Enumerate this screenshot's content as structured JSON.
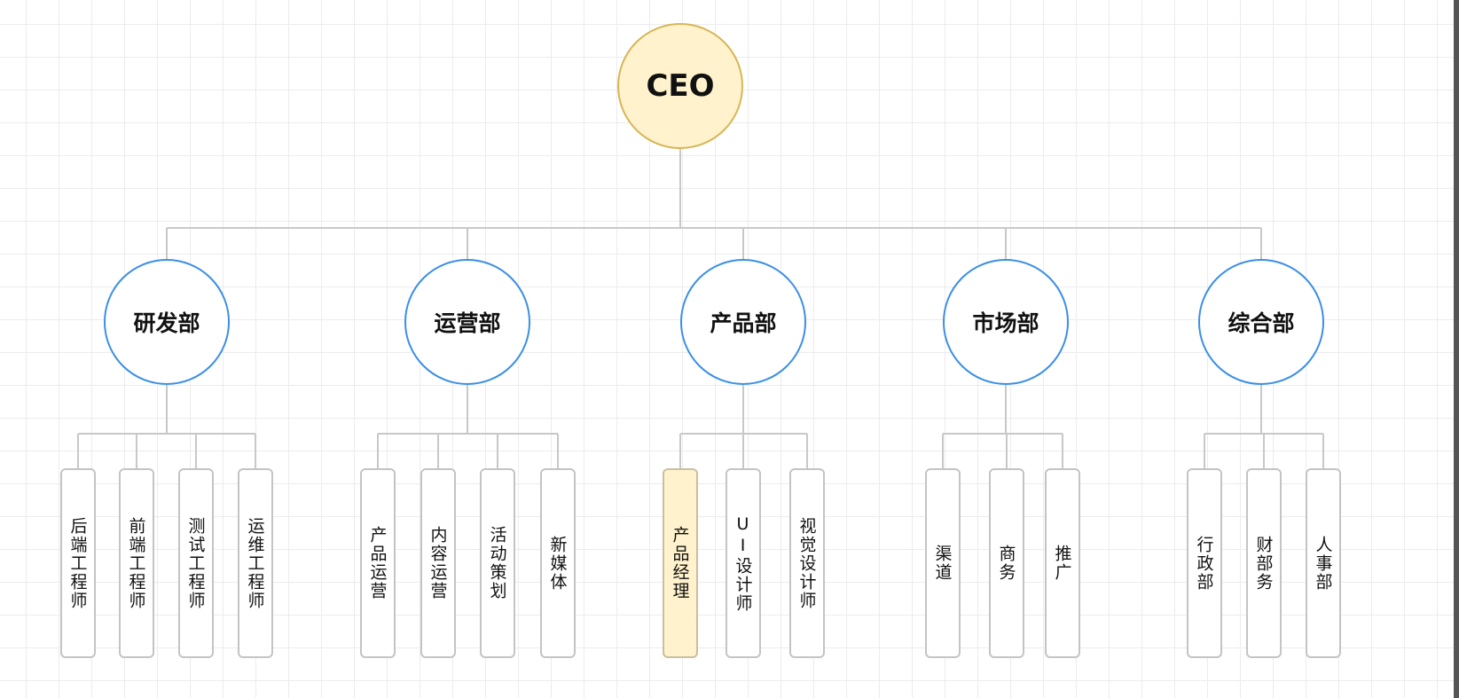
{
  "ceo": {
    "label": "CEO"
  },
  "departments": [
    {
      "label": "研发部",
      "children": [
        "后端工程师",
        "前端工程师",
        "测试工程师",
        "运维工程师"
      ]
    },
    {
      "label": "运营部",
      "children": [
        "产品运营",
        "内容运营",
        "活动策划",
        "新媒体"
      ]
    },
    {
      "label": "产品部",
      "children": [
        "产品经理",
        "UI设计师",
        "视觉设计师"
      ],
      "highlighted_child": 0
    },
    {
      "label": "市场部",
      "children": [
        "渠道",
        "商务",
        "推广"
      ]
    },
    {
      "label": "综合部",
      "children": [
        "行政部",
        "财部务",
        "人事部"
      ]
    }
  ],
  "colors": {
    "dept_border": "#3b8fe6",
    "ceo_fill": "#fff2cc",
    "ceo_border": "#d6b656",
    "highlight_fill": "#fff2cc",
    "connector": "#c8c8c8"
  }
}
